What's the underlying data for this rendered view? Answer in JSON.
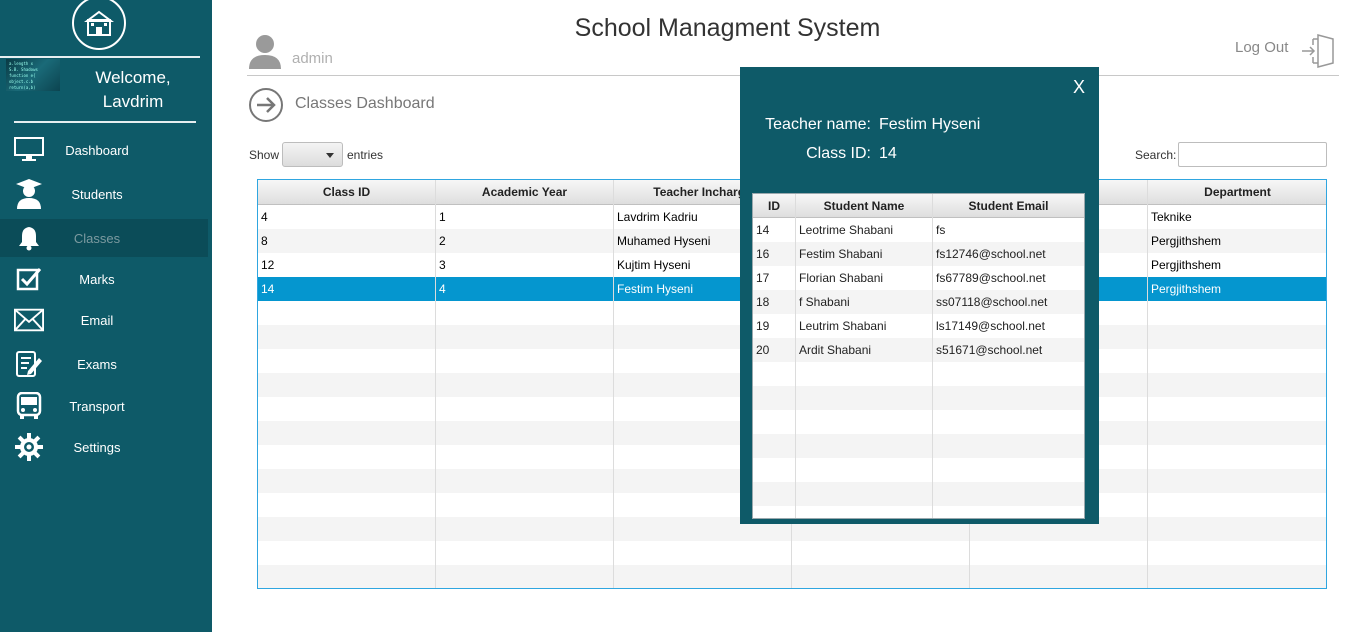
{
  "app": {
    "title": "School Managment System"
  },
  "sidebar": {
    "welcome_line1": "Welcome,",
    "welcome_line2": "Lavdrim",
    "items": [
      {
        "label": "Dashboard",
        "icon": "monitor-icon"
      },
      {
        "label": "Students",
        "icon": "graduate-icon"
      },
      {
        "label": "Classes",
        "icon": "bell-icon",
        "active": true
      },
      {
        "label": "Marks",
        "icon": "checkbox-icon"
      },
      {
        "label": "Email",
        "icon": "envelope-icon"
      },
      {
        "label": "Exams",
        "icon": "exam-icon"
      },
      {
        "label": "Transport",
        "icon": "bus-icon"
      },
      {
        "label": "Settings",
        "icon": "gear-icon"
      }
    ],
    "logo_image_text": "a.length... school code"
  },
  "header": {
    "user": "admin",
    "logout": "Log Out",
    "section_title": "Classes Dashboard"
  },
  "controls": {
    "show_label": "Show",
    "entries_label": "entries",
    "search_label": "Search:",
    "search_value": ""
  },
  "classes_table": {
    "columns": [
      "Class ID",
      "Academic Year",
      "Teacher Incharge",
      "",
      "",
      "Department"
    ],
    "rows": [
      [
        "4",
        "1",
        "Lavdrim Kadriu",
        "",
        "",
        "Teknike"
      ],
      [
        "8",
        "2",
        "Muhamed Hyseni",
        "",
        "",
        "Pergjithshem"
      ],
      [
        "12",
        "3",
        "Kujtim Hyseni",
        "",
        "",
        "Pergjithshem"
      ],
      [
        "14",
        "4",
        "Festim Hyseni",
        "",
        "",
        "Pergjithshem"
      ]
    ],
    "selected_row": 3
  },
  "popup": {
    "close": "X",
    "teacher_label": "Teacher name:",
    "teacher_value": "Festim Hyseni",
    "class_label": "Class ID:",
    "class_value": "14",
    "columns": [
      "ID",
      "Student Name",
      "Student Email"
    ],
    "rows": [
      [
        "14",
        "Leotrime  Shabani",
        "fs"
      ],
      [
        "16",
        "Festim Shabani",
        "fs12746@school.net"
      ],
      [
        "17",
        "Florian Shabani",
        "fs67789@school.net"
      ],
      [
        "18",
        "f Shabani",
        "ss07118@school.net"
      ],
      [
        "19",
        "Leutrim Shabani",
        "ls17149@school.net"
      ],
      [
        "20",
        "Ardit Shabani",
        "s51671@school.net"
      ]
    ]
  },
  "colors": {
    "sidebar": "#0e5a68",
    "selection": "#0596cf",
    "table_border": "#2fa6e0"
  }
}
